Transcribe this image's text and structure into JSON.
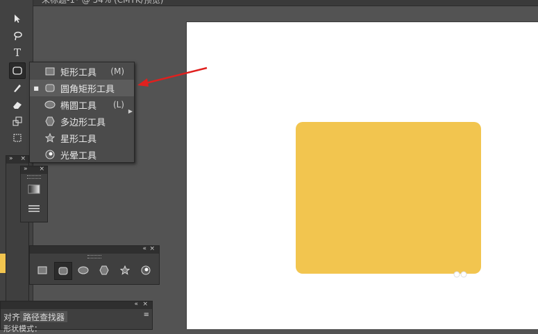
{
  "document": {
    "tab_title": "未标题-1* @ 54% (CMYK/预览)"
  },
  "flyout": {
    "items": [
      {
        "label": "矩形工具",
        "shortcut": "(M)",
        "icon": "rectangle-icon",
        "selected": false
      },
      {
        "label": "圆角矩形工具",
        "shortcut": "",
        "icon": "rounded-rectangle-icon",
        "selected": true
      },
      {
        "label": "椭圆工具",
        "shortcut": "(L)",
        "icon": "ellipse-icon",
        "selected": false
      },
      {
        "label": "多边形工具",
        "shortcut": "",
        "icon": "polygon-icon",
        "selected": false
      },
      {
        "label": "星形工具",
        "shortcut": "",
        "icon": "star-icon",
        "selected": false
      },
      {
        "label": "光晕工具",
        "shortcut": "",
        "icon": "flare-icon",
        "selected": false
      }
    ]
  },
  "toolbar": {
    "type_tool": "T"
  },
  "panels": {
    "bottom_tabs": [
      {
        "label": "对齐"
      },
      {
        "label": "路径查找器"
      }
    ],
    "bottom_subtext": "形状模式："
  },
  "colors": {
    "shape_fill": "#f2c54f",
    "annotation_arrow": "#e0201e",
    "artboard": "#ffffff"
  }
}
